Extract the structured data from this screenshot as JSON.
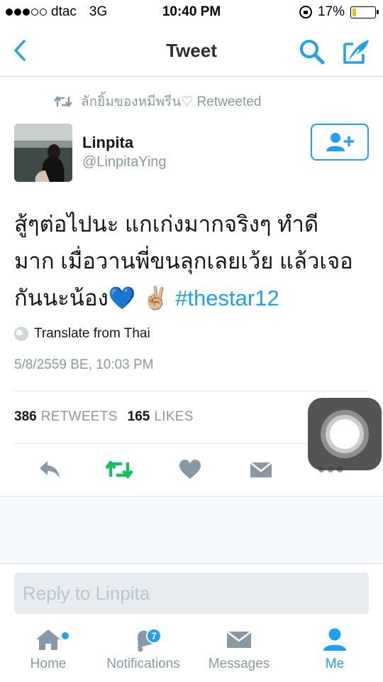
{
  "status_bar": {
    "carrier": "dtac",
    "network": "3G",
    "time": "10:40 PM",
    "battery": "17%",
    "battery_level": 0.17,
    "battery_color": "#f5c400"
  },
  "nav": {
    "title": "Tweet",
    "back_icon": "chevron-left-icon",
    "search_icon": "search-icon",
    "compose_icon": "compose-icon"
  },
  "tweet": {
    "retweeted_by": "ลักยิ้มของหมีพรีน♡ Retweeted",
    "author_name": "Linpita",
    "author_handle": "@LinpitaYing",
    "text_line1": "สู้ๆต่อไปนะ แกเก่งมากจริงๆ ทำดี",
    "text_line2": "มาก เมื่อวานพี่ขนลุกเลยเว้ย แล้วเจอ",
    "text_line3": "กันนะน้อง💙 ✌🏼",
    "hashtag": "#thestar12",
    "translate": "Translate from Thai",
    "timestamp": "5/8/2559 BE, 10:03 PM",
    "retweet_count": "386",
    "retweet_label": "RETWEETS",
    "like_count": "165",
    "like_label": "LIKES"
  },
  "reply": {
    "placeholder": "Reply to Linpita"
  },
  "tabs": [
    {
      "label": "Home",
      "icon": "home-icon"
    },
    {
      "label": "Notifications",
      "icon": "bell-icon",
      "badge": "7"
    },
    {
      "label": "Messages",
      "icon": "envelope-icon"
    },
    {
      "label": "Me",
      "icon": "person-icon"
    }
  ],
  "colors": {
    "accent": "#1da1f2",
    "retweet_green": "#17bf63",
    "secondary_text": "#8899a6"
  }
}
